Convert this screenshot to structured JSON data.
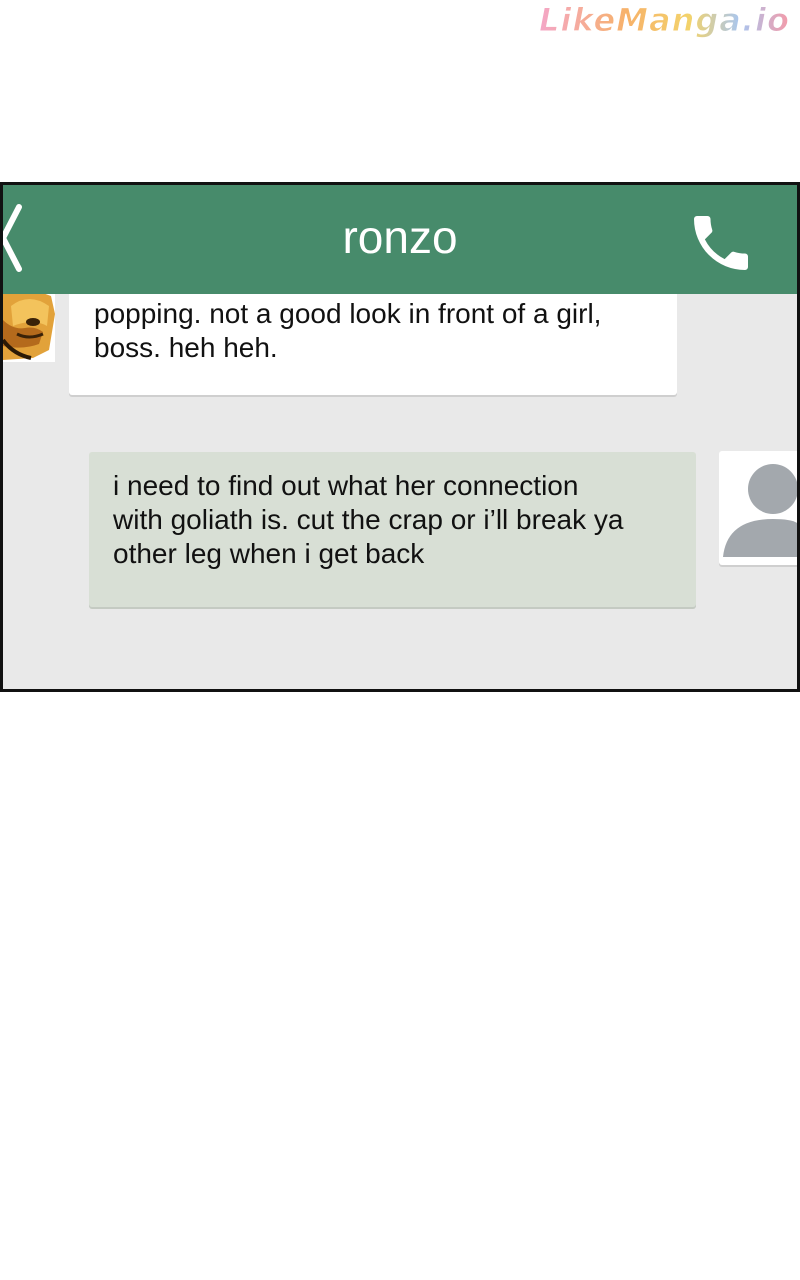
{
  "watermark": {
    "text": "LikeManga.io"
  },
  "chat": {
    "contact_name": "ronzo",
    "icons": {
      "back": "back-chevron-icon",
      "call": "phone-icon",
      "contact_avatar": "contact-avatar",
      "self_avatar": "default-user-icon"
    },
    "colors": {
      "header": "#478b6b",
      "incoming_bubble": "#ffffff",
      "outgoing_bubble": "#d8dfd5",
      "background": "#e9e9e9"
    },
    "messages": [
      {
        "sender": "ronzo",
        "direction": "incoming",
        "lines": [
          "popping. not a good look in front of a girl,",
          "boss. heh heh."
        ]
      },
      {
        "sender": "me",
        "direction": "outgoing",
        "lines": [
          "i need to find out what her connection",
          "with goliath is. cut the crap or i’ll break ya",
          "other leg when i get back"
        ]
      }
    ]
  }
}
